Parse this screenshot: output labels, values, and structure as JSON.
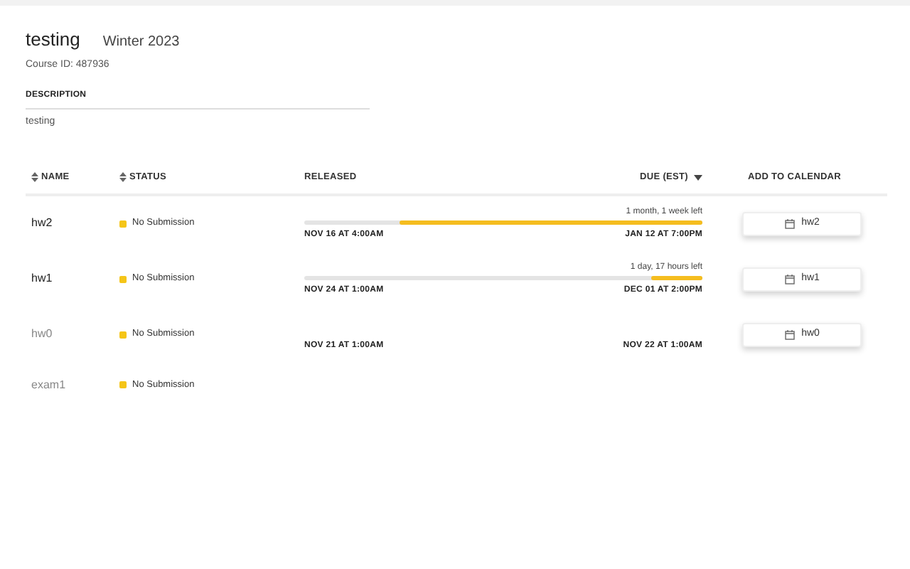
{
  "course": {
    "title": "testing",
    "term": "Winter 2023",
    "course_id": "Course ID: 487936"
  },
  "description": {
    "heading": "DESCRIPTION",
    "text": "testing"
  },
  "table": {
    "columns": [
      {
        "label": "NAME",
        "kind": "sortable"
      },
      {
        "label": "STATUS",
        "kind": "sortable"
      },
      {
        "label": "RELEASED",
        "kind": "plain"
      },
      {
        "label": "DUE (EST)",
        "kind": "sorted"
      },
      {
        "label": "ADD TO CALENDAR",
        "kind": "plain"
      }
    ],
    "rows": [
      {
        "name": "hw2",
        "dimmed": false,
        "status": "No Submission",
        "released": "NOV 16 AT 4:00AM",
        "due": "JAN 12 AT 7:00PM",
        "time_left": "1 month, 1 week left",
        "level": 0.76,
        "calendar": "hw2"
      },
      {
        "name": "hw1",
        "dimmed": false,
        "status": "No Submission",
        "released": "NOV 24 AT 1:00AM",
        "due": "DEC 01 AT 2:00PM",
        "time_left": "1 day, 17 hours left",
        "level": 0.13,
        "calendar": "hw1"
      },
      {
        "name": "hw0",
        "dimmed": true,
        "status": "No Submission",
        "released": "NOV 21 AT 1:00AM",
        "due": "NOV 22 AT 1:00AM",
        "calendar": "hw0"
      },
      {
        "name": "exam1",
        "dimmed": true,
        "status": "No Submission"
      }
    ]
  }
}
